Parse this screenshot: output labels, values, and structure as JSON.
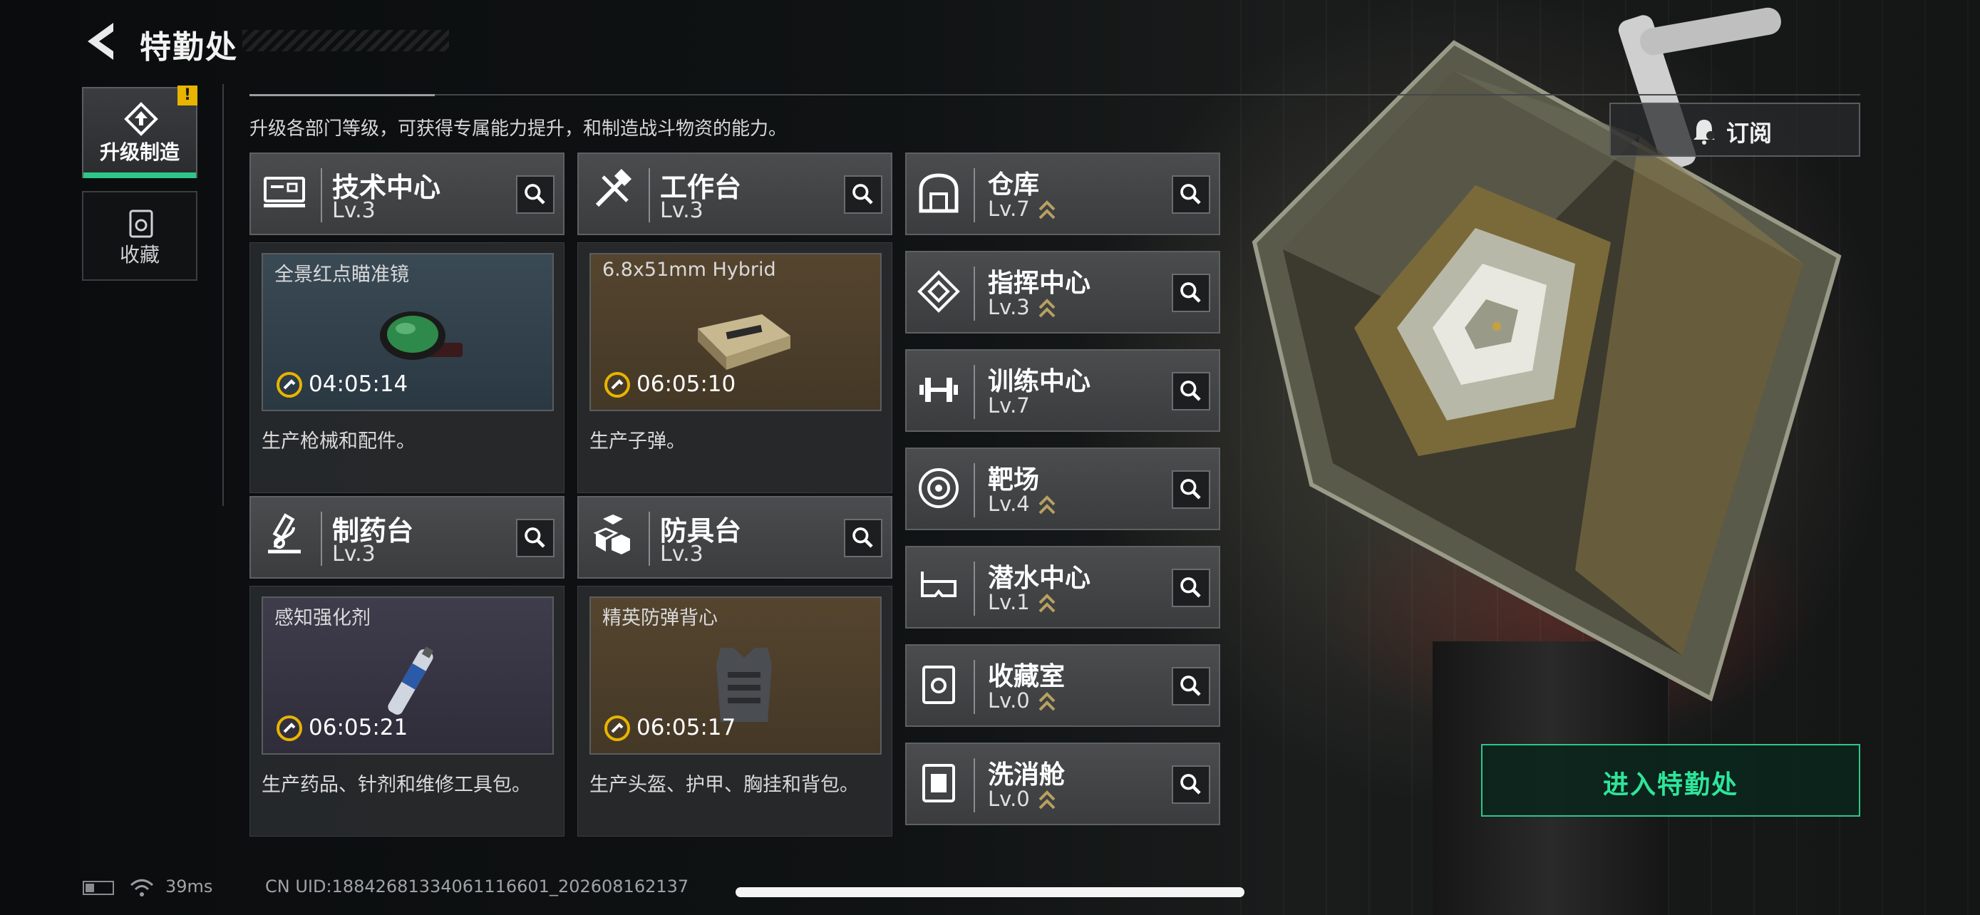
{
  "header": {
    "title": "特勤处",
    "back_icon": "back-arrow-icon"
  },
  "tabs": [
    {
      "label": "升级制造",
      "icon": "upgrade-icon",
      "selected": true,
      "badge": "!"
    },
    {
      "label": "收藏",
      "icon": "collection-icon",
      "selected": false
    }
  ],
  "description": "升级各部门等级，可获得专属能力提升，和制造战斗物资的能力。",
  "subscribe": {
    "label": "订阅",
    "icon": "bell-icon"
  },
  "cards": [
    {
      "name": "技术中心",
      "level": "Lv.3",
      "product": "全景红点瞄准镜",
      "timer": "04:05:14",
      "desc": "生产枪械和配件。",
      "icon": "tech-center-icon",
      "tone": "#2f3f4a"
    },
    {
      "name": "工作台",
      "level": "Lv.3",
      "product": "6.8x51mm Hybrid",
      "timer": "06:05:10",
      "desc": "生产子弹。",
      "icon": "workbench-icon",
      "tone": "#4a3d2f"
    },
    {
      "name": "制药台",
      "level": "Lv.3",
      "product": "感知强化剂",
      "timer": "06:05:21",
      "desc": "生产药品、针剂和维修工具包。",
      "icon": "pharmacy-icon",
      "tone": "#35333f"
    },
    {
      "name": "防具台",
      "level": "Lv.3",
      "product": "精英防弹背心",
      "timer": "06:05:17",
      "desc": "生产头盔、护甲、胸挂和背包。",
      "icon": "armor-bench-icon",
      "tone": "#4a3d2f"
    }
  ],
  "rows": [
    {
      "name": "仓库",
      "level": "Lv.7",
      "upgrade": true,
      "icon": "warehouse-icon"
    },
    {
      "name": "指挥中心",
      "level": "Lv.3",
      "upgrade": true,
      "icon": "command-center-icon"
    },
    {
      "name": "训练中心",
      "level": "Lv.7",
      "upgrade": false,
      "icon": "training-center-icon"
    },
    {
      "name": "靶场",
      "level": "Lv.4",
      "upgrade": true,
      "icon": "shooting-range-icon"
    },
    {
      "name": "潜水中心",
      "level": "Lv.1",
      "upgrade": true,
      "icon": "diving-center-icon"
    },
    {
      "name": "收藏室",
      "level": "Lv.0",
      "upgrade": true,
      "icon": "collection-room-icon"
    },
    {
      "name": "洗消舱",
      "level": "Lv.0",
      "upgrade": true,
      "icon": "decontamination-icon"
    }
  ],
  "enter_button": {
    "label": "进入特勤处"
  },
  "status": {
    "ping": "39ms",
    "uid": "CN UID:18842681334061116601_202608162137"
  },
  "colors": {
    "accent": "#2ec78a",
    "badge": "#e8b400"
  }
}
